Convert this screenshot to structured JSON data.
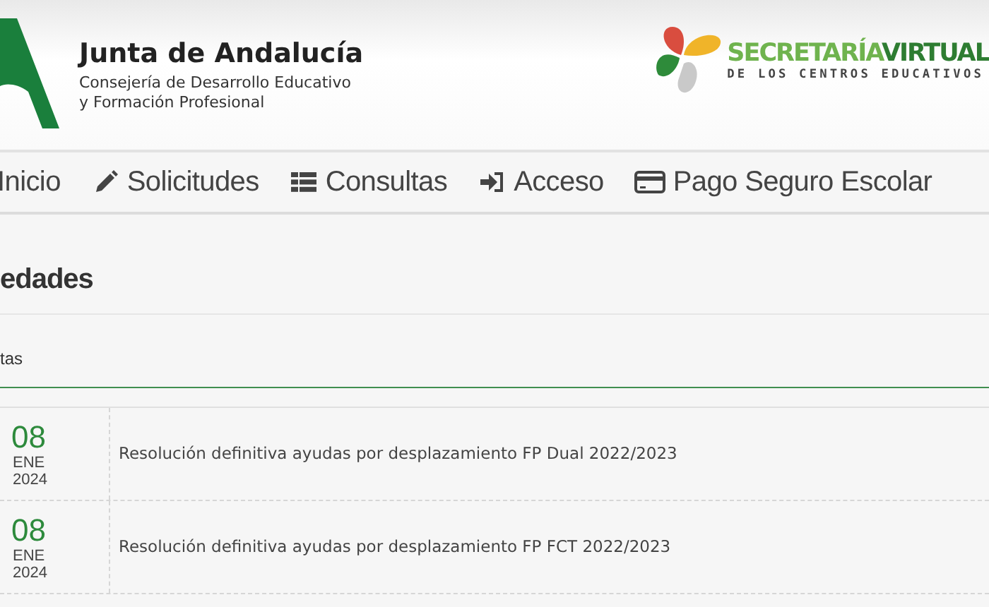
{
  "header": {
    "org_title": "Junta de Andalucía",
    "org_subtitle_1": "Consejería de Desarrollo Educativo",
    "org_subtitle_2": "y Formación Profesional",
    "brand_word_1": "SECRETARÍA",
    "brand_word_2": "VIRTUAL",
    "brand_tagline": "DE LOS CENTROS EDUCATIVOS"
  },
  "nav": [
    {
      "label": "Inicio"
    },
    {
      "label": "Solicitudes"
    },
    {
      "label": "Consultas"
    },
    {
      "label": "Acceso"
    },
    {
      "label": "Pago Seguro Escolar"
    }
  ],
  "section_title": "edades",
  "tab_label": "tas",
  "news": [
    {
      "day": "08",
      "month": "ENE",
      "year": "2024",
      "title": "Resolución definitiva ayudas por desplazamiento FP Dual 2022/2023"
    },
    {
      "day": "08",
      "month": "ENE",
      "year": "2024",
      "title": "Resolución definitiva ayudas por desplazamiento FP FCT 2022/2023"
    }
  ]
}
